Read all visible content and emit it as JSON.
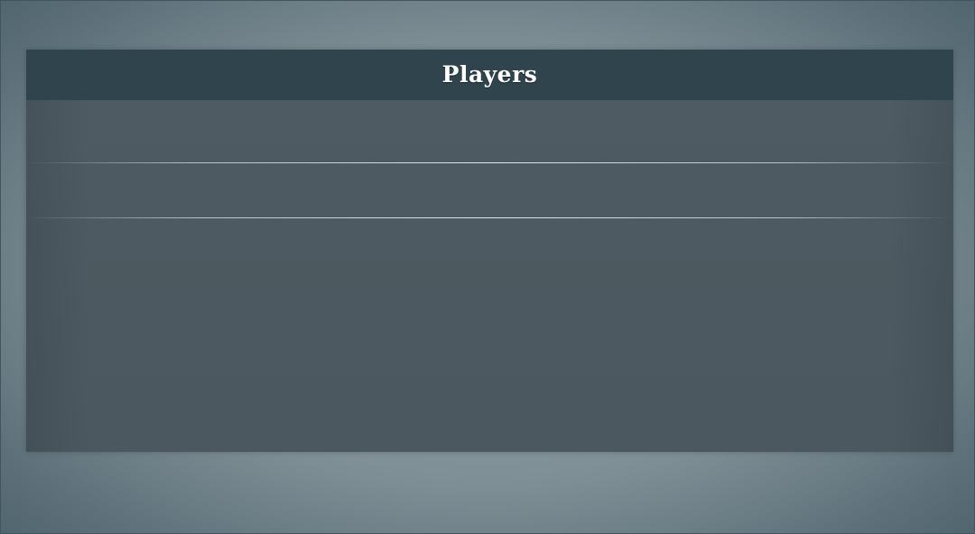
{
  "panel": {
    "title": "Players",
    "rows": [
      {
        "name": ""
      },
      {
        "name": ""
      }
    ]
  },
  "colors": {
    "header_background": "#2f444c",
    "panel_background": "#4c5960",
    "title_text": "#ffffff",
    "page_background": "#7e8e95"
  }
}
